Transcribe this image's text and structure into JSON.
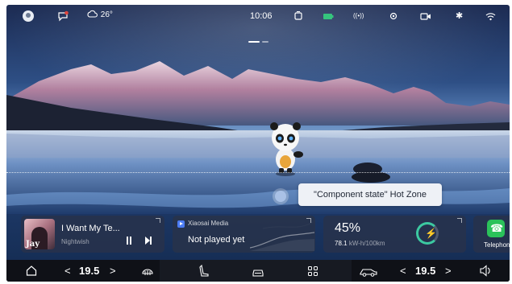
{
  "status_bar": {
    "weather_icon": "cloud-icon",
    "temperature": "26°",
    "time": "10:06",
    "icons": [
      "user-icon",
      "message-icon",
      "cloud-icon",
      "car-seat-icon",
      "battery-icon",
      "signal-icon",
      "location-icon",
      "camera-icon",
      "bluetooth-icon",
      "wifi-icon"
    ]
  },
  "hot_zone": {
    "label": "\"Component state\" Hot Zone"
  },
  "music_card": {
    "song": "I Want My Te...",
    "artist": "Nightwish",
    "album_text": "Jay"
  },
  "media_card": {
    "app_name": "Xiaosai Media",
    "status": "Not played yet"
  },
  "energy_card": {
    "percent": "45%",
    "consumption": "78.1",
    "unit": "kW-h/100km",
    "level": 0.45
  },
  "phone_card": {
    "label": "Telephone"
  },
  "dock": {
    "left_temp": "19.5",
    "right_temp": "19.5",
    "decrease_symbol": "<",
    "increase_symbol": ">",
    "items": [
      "home-icon",
      "defrost-icon",
      "seat-icon",
      "car-icon",
      "apps-icon",
      "car-side-icon",
      "volume-icon"
    ]
  },
  "colors": {
    "accent_green": "#3cc9a1",
    "phone_green": "#2bc25a",
    "dock_bg": "#171a22"
  }
}
